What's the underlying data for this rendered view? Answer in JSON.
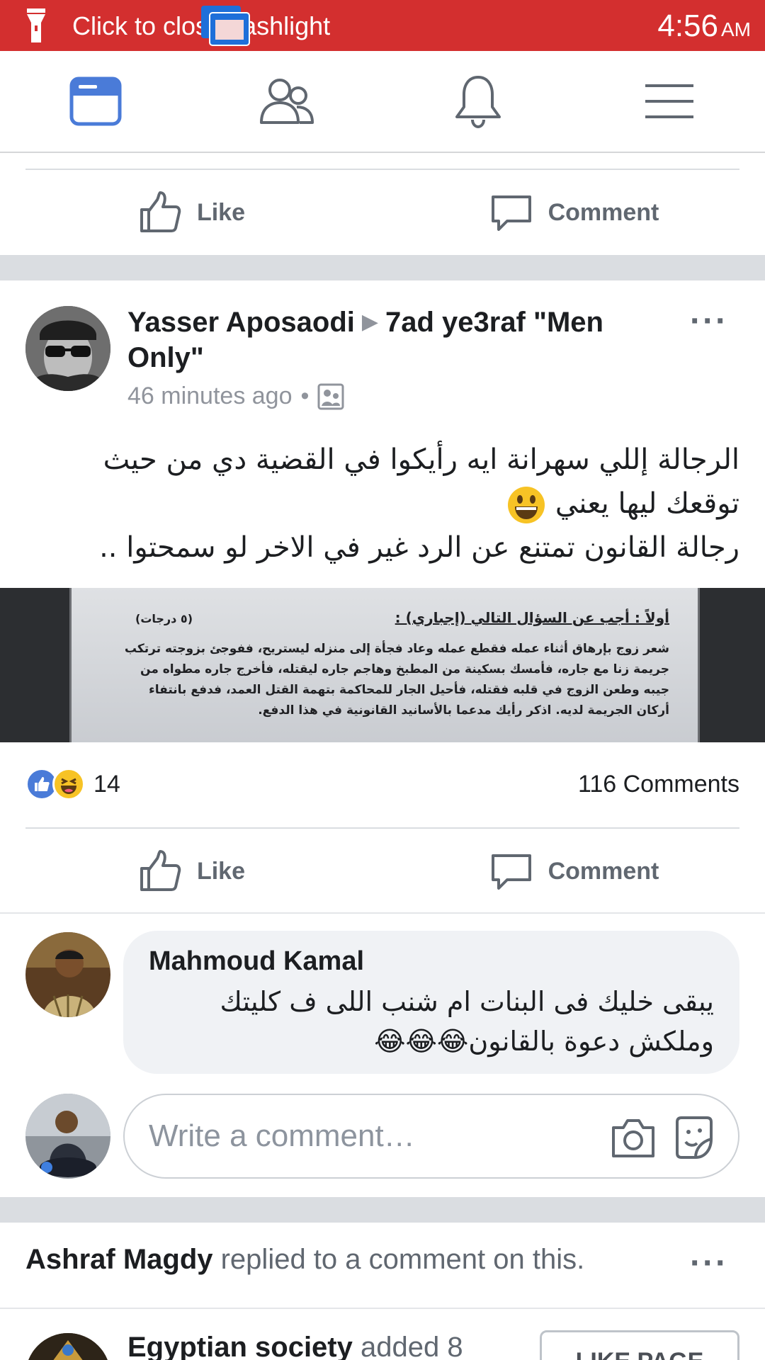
{
  "status_bar": {
    "notification_text": "Click to close flashlight",
    "time": "4:56",
    "ampm": "AM"
  },
  "top_nav": {
    "items": [
      "news-feed",
      "friends",
      "notifications",
      "menu"
    ],
    "active_color": "#4a7bd8"
  },
  "previous_post": {
    "like_label": "Like",
    "comment_label": "Comment"
  },
  "post": {
    "author": "Yasser Aposaodi",
    "separator": "▶",
    "group": "7ad ye3raf \"Men Only\"",
    "time_ago": "46 minutes ago",
    "meta_separator": "•",
    "text_line1": "الرجالة إللي سهرانة ايه رأيكوا في القضية دي من حيث",
    "text_line2": "توقعك ليها يعني",
    "text_line3": "رجالة القانون تمتنع عن الرد غير في الاخر لو سمحتوا ..",
    "photo": {
      "heading": "أولاً : أجب عن السؤال التالي (إجباري) :",
      "grade": "(٥ درجات)",
      "line1": "شعر زوج بإرهاق أثناء عمله فقطع عمله وعاد فجأة إلى منزله ليستريح، ففوجئ بزوجته ترتكب",
      "line2": "جريمة زنا مع جاره، فأمسك بسكينة من المطبخ وهاجم جاره ليقتله، فأخرج جاره مطواه من",
      "line3": "جيبه وطعن الزوج في قلبه فقتله، فأحيل الجار للمحاكمة بتهمة القتل العمد، فدفع بانتفاء",
      "line4": "أركان الجريمة لديه. اذكر رأيك مدعما بالأسانيد القانونية في هذا الدفع."
    },
    "reaction_count": "14",
    "comments_count": "116 Comments",
    "like_label": "Like",
    "comment_label": "Comment"
  },
  "comment": {
    "author": "Mahmoud Kamal",
    "line1": "يبقى خليك فى البنات ام شنب اللى ف كليتك",
    "line2": "وملكش دعوة بالقانون😂😂😂"
  },
  "write_comment": {
    "placeholder": "Write a comment…"
  },
  "activity": {
    "actor": "Ashraf Magdy",
    "text": " replied to a comment on this."
  },
  "next_post": {
    "page": "Egyptian society",
    "text": " added 8",
    "button_label": "LIKE PAGE"
  },
  "colors": {
    "status_bar": "#d32f2f",
    "facebook_blue": "#4a7bd8",
    "secondary_text": "#606770",
    "divider": "#dadde1"
  }
}
